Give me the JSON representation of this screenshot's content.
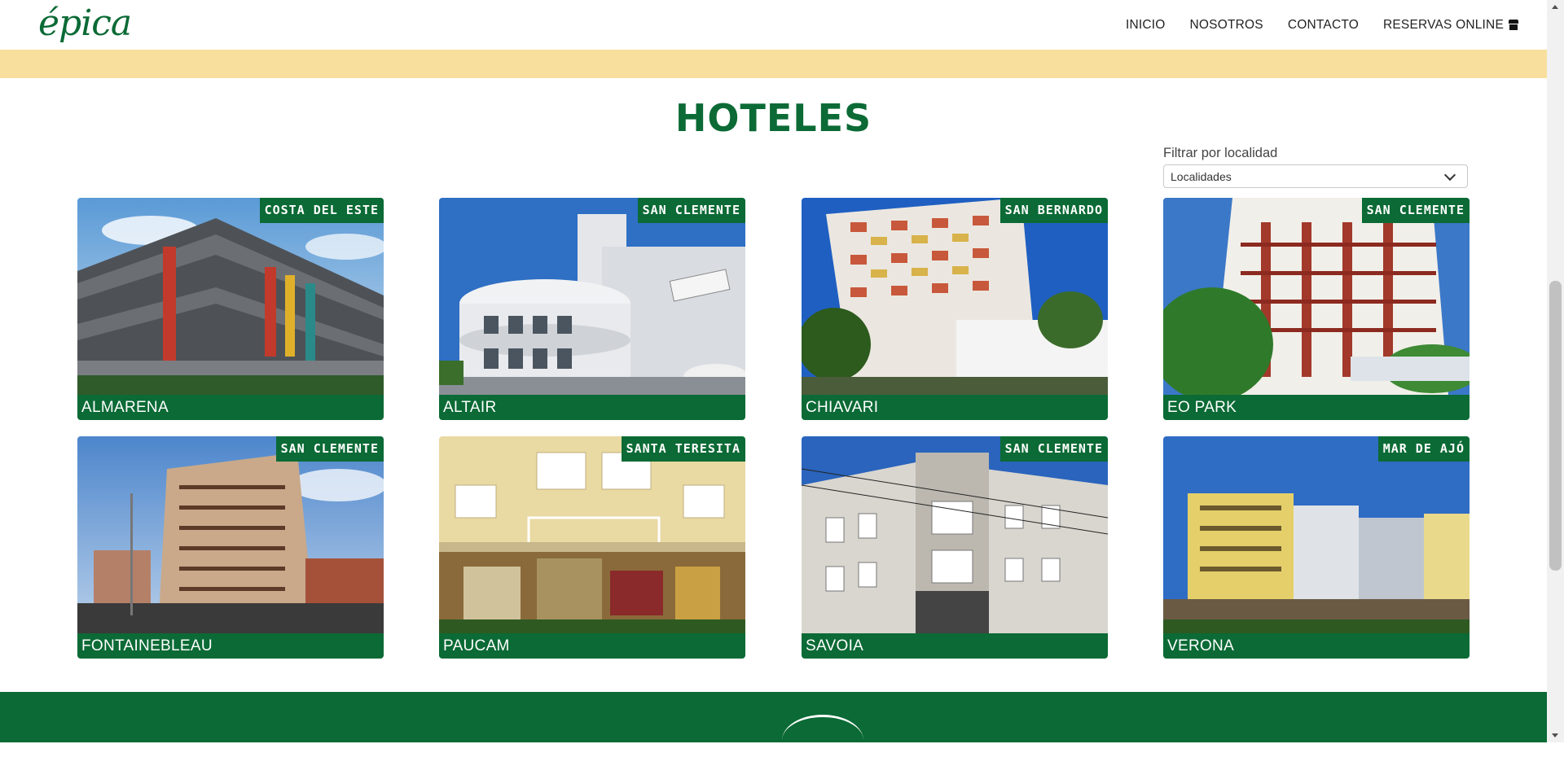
{
  "header": {
    "logo": "épica",
    "nav": [
      {
        "label": "INICIO"
      },
      {
        "label": "NOSOTROS"
      },
      {
        "label": "CONTACTO"
      },
      {
        "label": "RESERVAS ONLINE"
      }
    ]
  },
  "main": {
    "title": "HOTELES",
    "filter": {
      "label": "Filtrar por localidad",
      "selected": "Localidades"
    }
  },
  "hotels": [
    {
      "name": "ALMARENA",
      "location": "COSTA DEL ESTE"
    },
    {
      "name": "ALTAIR",
      "location": "SAN CLEMENTE"
    },
    {
      "name": "CHIAVARI",
      "location": "SAN BERNARDO"
    },
    {
      "name": "EO PARK",
      "location": "SAN CLEMENTE"
    },
    {
      "name": "FONTAINEBLEAU",
      "location": "SAN CLEMENTE"
    },
    {
      "name": "PAUCAM",
      "location": "SANTA TERESITA"
    },
    {
      "name": "SAVOIA",
      "location": "SAN CLEMENTE"
    },
    {
      "name": "VERONA",
      "location": "MAR DE AJÓ"
    }
  ],
  "colors": {
    "brand_green": "#0b6a35",
    "band_yellow": "#f8df9d"
  }
}
